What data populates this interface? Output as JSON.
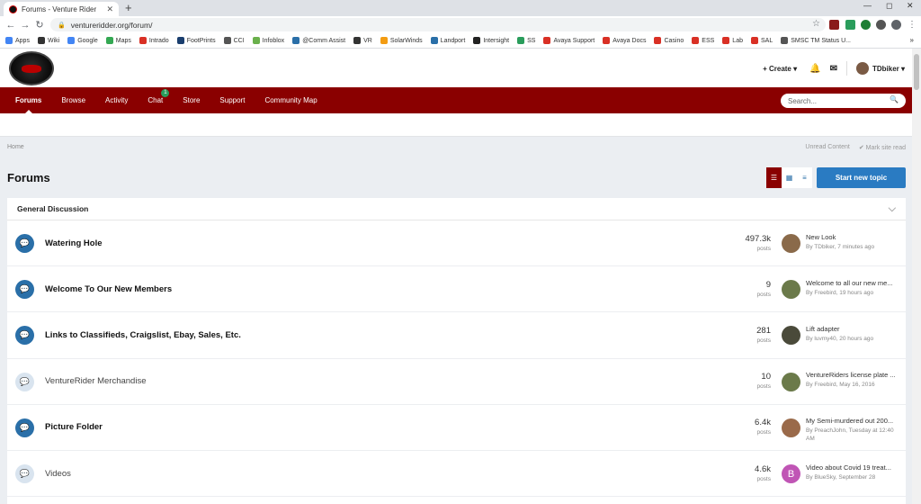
{
  "browser": {
    "tab_title": "Forums - Venture Rider",
    "url": "ventureridder.org/forum/",
    "controls": {
      "minimize": "—",
      "maximize": "◻",
      "close": "✕"
    }
  },
  "bookmarks": [
    {
      "label": "Apps",
      "color": "#4285f4"
    },
    {
      "label": "Wiki",
      "color": "#333333"
    },
    {
      "label": "Google",
      "color": "#4285f4"
    },
    {
      "label": "Maps",
      "color": "#34a853"
    },
    {
      "label": "Intrado",
      "color": "#d93025"
    },
    {
      "label": "FootPrints",
      "color": "#1a3e6e"
    },
    {
      "label": "CCI",
      "color": "#555555"
    },
    {
      "label": "Infoblox",
      "color": "#6ab04c"
    },
    {
      "label": "@Comm Assist",
      "color": "#2a6fa8"
    },
    {
      "label": "VR",
      "color": "#333333"
    },
    {
      "label": "SolarWinds",
      "color": "#f39c12"
    },
    {
      "label": "Landport",
      "color": "#2a6fa8"
    },
    {
      "label": "Intersight",
      "color": "#222222"
    },
    {
      "label": "SS",
      "color": "#2a9d5c"
    },
    {
      "label": "Avaya Support",
      "color": "#d93025"
    },
    {
      "label": "Avaya Docs",
      "color": "#d93025"
    },
    {
      "label": "Casino",
      "color": "#d93025"
    },
    {
      "label": "ESS",
      "color": "#d93025"
    },
    {
      "label": "Lab",
      "color": "#d93025"
    },
    {
      "label": "SAL",
      "color": "#d93025"
    },
    {
      "label": "SMSC TM Status U...",
      "color": "#555555"
    }
  ],
  "header": {
    "create_label": "+ Create ▾",
    "username": "TDbiker ▾"
  },
  "nav": {
    "items": [
      "Forums",
      "Browse",
      "Activity",
      "Chat",
      "Store",
      "Support",
      "Community Map"
    ],
    "chat_badge": "1",
    "search_placeholder": "Search..."
  },
  "breadcrumb": {
    "home": "Home",
    "unread": "Unread Content",
    "mark_read": "✔ Mark site read"
  },
  "page": {
    "title": "Forums",
    "start_topic": "Start new topic"
  },
  "category": {
    "title": "General Discussion"
  },
  "forums": [
    {
      "name": "Watering Hole",
      "count": "497.3k",
      "unit": "posts",
      "unread": true,
      "last_title": "New Look",
      "last_by": "By TDbiker, 7 minutes ago",
      "av_color": "#8a6a4a"
    },
    {
      "name": "Welcome To Our New Members",
      "count": "9",
      "unit": "posts",
      "unread": true,
      "last_title": "Welcome to all our new me...",
      "last_by": "By Freebird, 19 hours ago",
      "av_color": "#6b7a4a"
    },
    {
      "name": "Links to Classifieds, Craigslist, Ebay, Sales, Etc.",
      "count": "281",
      "unit": "posts",
      "unread": true,
      "last_title": "Lift adapter",
      "last_by": "By luvmy40, 20 hours ago",
      "av_color": "#4a4a3a"
    },
    {
      "name": "VentureRider Merchandise",
      "count": "10",
      "unit": "posts",
      "unread": false,
      "last_title": "VentureRiders license plate ...",
      "last_by": "By Freebird, May 16, 2016",
      "av_color": "#6b7a4a"
    },
    {
      "name": "Picture Folder",
      "count": "6.4k",
      "unit": "posts",
      "unread": true,
      "last_title": "My Semi-murdered out 200...",
      "last_by": "By PreachJohn, Tuesday at 12:40 AM",
      "av_color": "#9a6a4a"
    },
    {
      "name": "Videos",
      "count": "4.6k",
      "unit": "posts",
      "unread": false,
      "last_title": "Video about Covid 19 treat...",
      "last_by": "By BlueSky, September 28",
      "av_color": "#c055b5",
      "av_letter": "B"
    }
  ]
}
